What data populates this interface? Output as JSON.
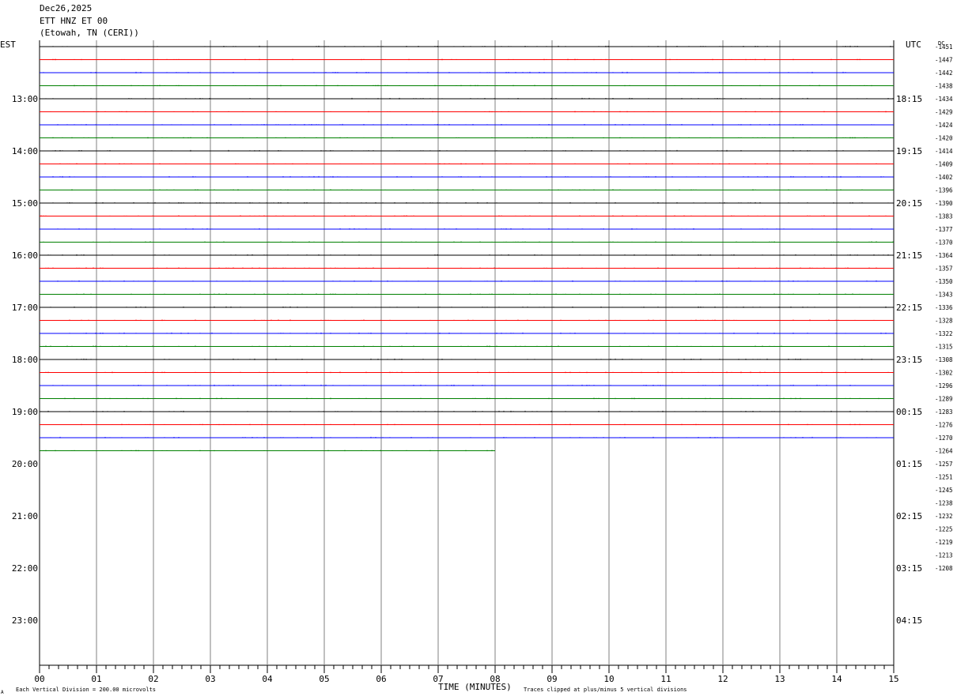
{
  "header": {
    "date": "Dec26,2025",
    "station": "ETT HNZ ET 00",
    "location": "(Etowah, TN (CERI))"
  },
  "left_axis_title": "EST",
  "right_axis_title": "UTC",
  "dc_label": "DC",
  "xlabel": "TIME (MINUTES)",
  "footer_left": "Each Vertical Division =  200.00 microvolts",
  "footer_right": "Traces clipped at plus/minus 5 vertical divisions",
  "footer_mark": "A",
  "colors": {
    "trace_cycle": [
      "#000000",
      "#ff0000",
      "#0000ff",
      "#008000"
    ],
    "grid": "#808080",
    "frame": "#000000"
  },
  "chart_data": {
    "type": "line",
    "title": "ETT HNZ ET 00",
    "xlim": [
      0,
      15
    ],
    "x_ticks": [
      "00",
      "01",
      "02",
      "03",
      "04",
      "05",
      "06",
      "07",
      "08",
      "09",
      "10",
      "11",
      "12",
      "13",
      "14",
      "15"
    ],
    "left_time_labels": [
      "13:00",
      "14:00",
      "15:00",
      "16:00",
      "17:00",
      "18:00",
      "19:00",
      "20:00",
      "21:00",
      "22:00",
      "23:00"
    ],
    "right_time_labels": [
      "18:15",
      "19:15",
      "20:15",
      "21:15",
      "22:15",
      "23:15",
      "00:15",
      "01:15",
      "02:15",
      "03:15",
      "04:15"
    ],
    "traces_per_hour": 4,
    "total_rows": 32,
    "last_trace_end_minute": 8,
    "dc_offsets": [
      "-1451",
      "-1447",
      "-1442",
      "-1438",
      "-1434",
      "-1429",
      "-1424",
      "-1420",
      "-1414",
      "-1409",
      "-1402",
      "-1396",
      "-1390",
      "-1383",
      "-1377",
      "-1370",
      "-1364",
      "-1357",
      "-1350",
      "-1343",
      "-1336",
      "-1328",
      "-1322",
      "-1315",
      "-1308",
      "-1302",
      "-1296",
      "-1289",
      "-1283",
      "-1276",
      "-1270",
      "-1264",
      "-1257",
      "-1251",
      "-1245",
      "-1238",
      "-1232",
      "-1225",
      "-1219",
      "-1213",
      "-1208"
    ]
  }
}
